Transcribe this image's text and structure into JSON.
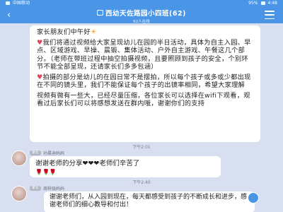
{
  "status_bar": {
    "left_text": "中国移动",
    "right_text": "4:48",
    "battery": "95%"
  },
  "header": {
    "back_label": "",
    "title": "西幼天佐路园小四班(62)",
    "subtitle": "62人在线",
    "icons": {
      "back": "chevron-left-icon",
      "group": "group-icon",
      "menu": "menu-icon"
    }
  },
  "announcement": {
    "paragraphs": [
      "家长朋友们中午好",
      "我们将通过视频给大家呈现幼儿在园的半日活动，具体为自主入园、早点、区域游戏、早操、晨锻、集体活动、户外自主游戏、午餐这几个部分。（老师在带班过程中抽空拍摄视频，且要照顾到孩子的安全，个别环节不能全部呈现，还请家长们多多包涵）",
      "拍摄的部分是幼儿的在园日常不是摆拍，所以每个孩子或多或少都出现在不同的镜头里，我们不能保证每个孩子的出镜率相同，希望大家理解",
      "视频有微有一些大，已经尽量压缩，各位家长可以选择在wifi下观看，观看过后家长们可以将感想发送在群内哦，谢谢你们的支持"
    ]
  },
  "messages": [
    {
      "timestamp": "下午2:01",
      "sender": "孙晨迪妈妈",
      "role": "家长",
      "text": "谢谢老师的分享❤❤❤老师们辛苦了",
      "extra": "🌹🌹🌹"
    },
    {
      "timestamp": "下午2:40",
      "sender": "周梓骁妈妈",
      "role": "家长",
      "text": "谢谢老师们，从入园到现在，每天都感受到孩子的不断成长和进步，感谢老师们的细心教导和付出！",
      "extra": "❤❤"
    }
  ],
  "colors": {
    "accent": "#4a95e6",
    "background": "#d7dff0",
    "bubble": "#ffffff"
  }
}
